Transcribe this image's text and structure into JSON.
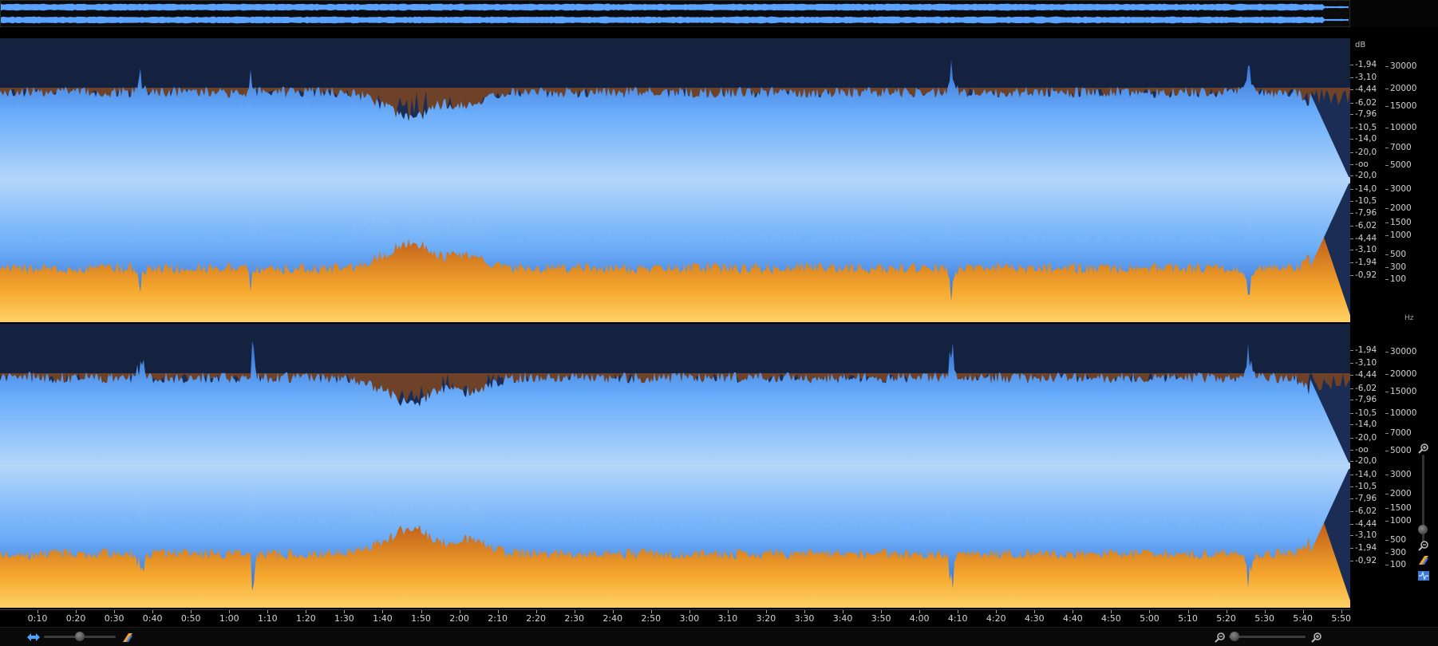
{
  "app": {
    "view": "spectrogram/waveform"
  },
  "colors": {
    "background": "#000000",
    "spectrum_low": "#f4a72a",
    "spectrum_high": "#8a4712",
    "waveform_fill_light": "#a9d2ff",
    "waveform_fill_dark": "#2f6fd8",
    "spectro_bg": "#1c2d55",
    "overview_wave": "#5aa2ff"
  },
  "scale": {
    "db_unit": "dB",
    "hz_unit": "Hz",
    "db_labels": [
      "-1,94",
      "-3,10",
      "-4,44",
      "-6,02",
      "-7,96",
      "-10,5",
      "-14,0",
      "-20,0",
      "-oo",
      "-20,0",
      "-14,0",
      "-10,5",
      "-7,96",
      "-6,02",
      "-4,44",
      "-3,10",
      "-1,94",
      "-0,92"
    ],
    "hz_labels": [
      "30000",
      "20000",
      "15000",
      "10000",
      "7000",
      "5000",
      "3000",
      "2000",
      "1500",
      "1000",
      "500",
      "300",
      "100"
    ]
  },
  "timeline": {
    "unit_label": "hms",
    "labels": [
      "0:10",
      "0:20",
      "0:30",
      "0:40",
      "0:50",
      "1:00",
      "1:10",
      "1:20",
      "1:30",
      "1:40",
      "1:50",
      "2:00",
      "2:10",
      "2:20",
      "2:30",
      "2:40",
      "2:50",
      "3:00",
      "3:10",
      "3:20",
      "3:30",
      "3:40",
      "3:50",
      "4:00",
      "4:10",
      "4:20",
      "4:30",
      "4:40",
      "4:50",
      "5:00",
      "5:10",
      "5:20",
      "5:30",
      "5:40",
      "5:50"
    ]
  },
  "controls": {
    "horizontal_zoom_level": 0.5,
    "spectrogram_blend_level": 0.5,
    "vertical_zoom_level": 0.85,
    "icons": [
      "horizontal-fit-icon",
      "spectrogram-toggle-icon",
      "zoom-out-icon",
      "zoom-in-icon",
      "vertical-zoom-in-icon",
      "vertical-zoom-out-icon",
      "spectrum-mode-icon",
      "waveform-mode-icon"
    ]
  }
}
